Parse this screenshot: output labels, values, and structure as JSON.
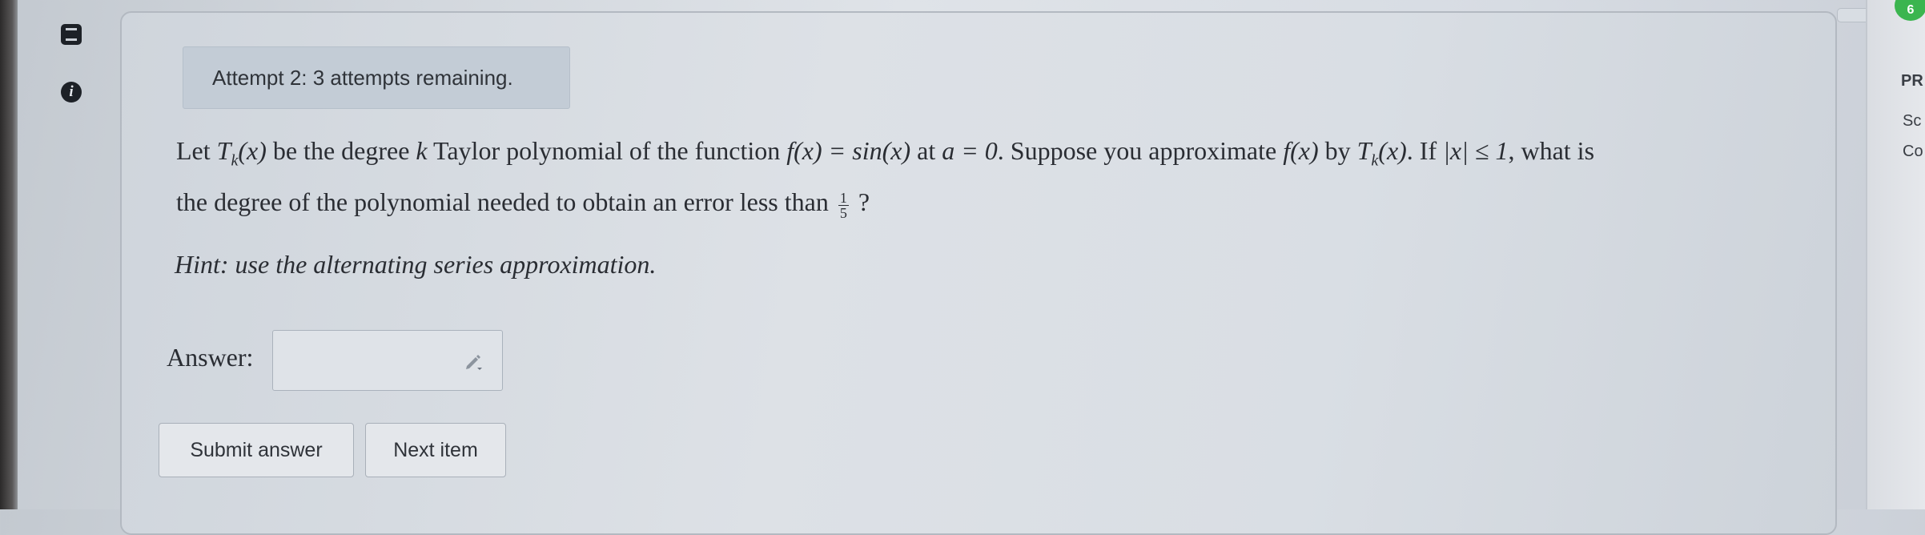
{
  "banner": {
    "text": "Attempt 2: 3 attempts remaining."
  },
  "question": {
    "w1": "Let",
    "T": "T",
    "k": "k",
    "x_arg": "(x)",
    "w2": "be the degree",
    "k_var": "k",
    "w3": "Taylor polynomial of the function",
    "fx": "f(x) = sin(x)",
    "w4": "at",
    "a_eq": "a = 0",
    "w5": ". Suppose you approximate",
    "fx2": "f(x)",
    "w6": "by",
    "T2": "T",
    "k2": "k",
    "x_arg2": "(x)",
    "w7": ". If",
    "abs_cond": "|x| ≤ 1",
    "w8": ", what is",
    "line2": "the degree of the polynomial needed to obtain an error less than",
    "frac_num": "1",
    "frac_den": "5",
    "qmark": "?"
  },
  "hint": "Hint: use the alternating series approximation.",
  "answer": {
    "label": "Answer:",
    "value": ""
  },
  "buttons": {
    "submit": "Submit answer",
    "next": "Next item"
  },
  "right_panel": {
    "pr": "PR",
    "sc": "Sc",
    "co": "Co"
  },
  "badge": "6"
}
